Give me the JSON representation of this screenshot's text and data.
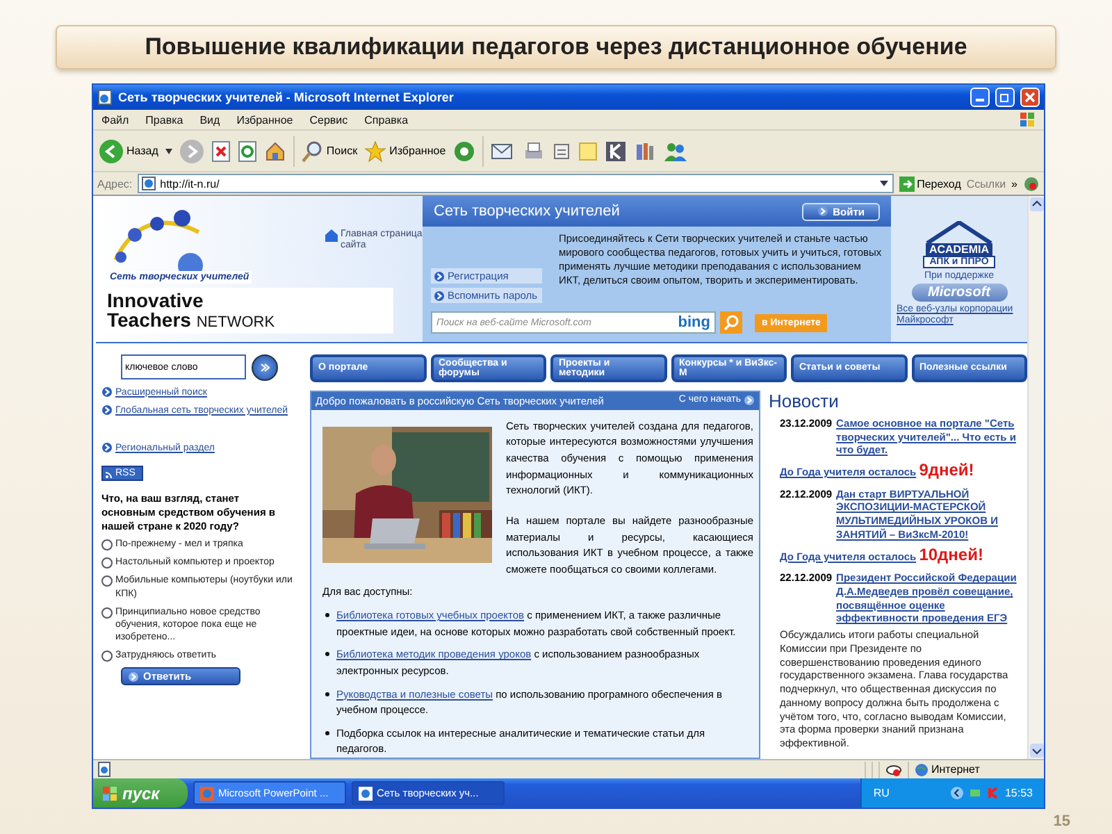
{
  "slide": {
    "title": "Повышение квалификации педагогов через дистанционное обучение",
    "number": "15"
  },
  "window": {
    "title": "Сеть творческих учителей - Microsoft Internet Explorer"
  },
  "menu": [
    "Файл",
    "Правка",
    "Вид",
    "Избранное",
    "Сервис",
    "Справка"
  ],
  "toolbar": {
    "back": "Назад",
    "search": "Поиск",
    "favorites": "Избранное"
  },
  "address": {
    "label": "Адрес:",
    "value": "http://it-n.ru/",
    "go": "Переход",
    "links": "Ссылки",
    "more": "»"
  },
  "header": {
    "logo_caption": "Сеть творческих учителей",
    "logo_line1": "Innovative",
    "logo_line2_bold": "Teachers",
    "logo_line2": "NETWORK",
    "home_link": "Главная страница сайта",
    "panel_title": "Сеть творческих учителей",
    "login": "Войти",
    "intro": "Присоединяйтесь к Сети творческих учителей и станьте частью мирового сообщества педагогов, готовых учить и учиться, готовых применять лучшие методики преподавания с использованием ИКТ, делиться своим опытом, творить и экспериментировать.",
    "links": [
      "Регистрация",
      "Вспомнить пароль"
    ],
    "search_placeholder": "Поиск на веб-сайте Microsoft.com",
    "search_brand": "bing",
    "internet_button": "в Интернете",
    "academia": "ACADEMIA",
    "academia_sub": "АПК и ППРО",
    "support": "При поддержке",
    "microsoft": "Microsoft",
    "ms_link": "Все веб-узлы корпорации Майкрософт"
  },
  "sidebar": {
    "keyword": "ключевое слово",
    "links": [
      "Расширенный поиск",
      "Глобальная сеть творческих учителей",
      "Региональный раздел"
    ],
    "rss": "RSS",
    "poll": {
      "question": "Что, на ваш взгляд, станет основным средством обучения в нашей стране к 2020 году?",
      "options": [
        {
          "label": "По-прежнему - мел и тряпка",
          "selected": false
        },
        {
          "label": "Настольный компьютер и проектор",
          "selected": false
        },
        {
          "label": "Мобильные компьютеры (ноутбуки или КПК)",
          "selected": false
        },
        {
          "label": "Принципиально новое средство обучения, которое пока еще не изобретено...",
          "selected": false
        },
        {
          "label": "Затрудняюсь ответить",
          "selected": false
        }
      ],
      "button": "Ответить"
    }
  },
  "nav": [
    "О портале",
    "Сообщества и форумы",
    "Проекты и методики",
    "Конкурсы * и ВиЗкс-М",
    "Статьи и советы",
    "Полезные ссылки"
  ],
  "welcome": {
    "title": "Добро пожаловать в российскую Сеть творческих учителей",
    "start": "С чего начать",
    "paragraphs": [
      "Сеть творческих учителей создана для педагогов, которые интересуются возможностями улучшения качества обучения с помощью применения информационных и коммуникационных технологий (ИКТ).",
      "На нашем портале вы найдете разнообразные материалы и ресурсы, касающиеся использования ИКТ в учебном процессе, а также сможете пообщаться со своими коллегами."
    ],
    "available": "Для вас доступны:",
    "bullets": [
      {
        "link": "Библиотека готовых учебных проектов",
        "text": " с применением ИКТ, а также различные проектные идеи, на основе которых можно разработать свой собственный проект."
      },
      {
        "link": "Библиотека методик проведения уроков",
        "text": " с использованием разнообразных электронных ресурсов."
      },
      {
        "link": "Руководства и полезные советы",
        "text": " по использованию програмного обеспечения в учебном процессе."
      },
      {
        "text": "Подборка ссылок на интересные аналитические и тематические статьи для педагогов."
      }
    ]
  },
  "news": {
    "title": "Новости",
    "items": [
      {
        "date": "23.12.2009",
        "link": "Самое основное на портале \"Сеть творческих учителей\"... Что есть и что будет.",
        "countdown": {
          "label": "До Года учителя осталось",
          "days": "9дней!"
        }
      },
      {
        "date": "22.12.2009",
        "link": "Дан старт ВИРТУАЛЬНОЙ ЭКСПОЗИЦИИ-МАСТЕРСКОЙ МУЛЬТИМЕДИЙНЫХ УРОКОВ И ЗАНЯТИЙ – ВиЗксМ-2010!",
        "countdown": {
          "label": "До Года учителя осталось",
          "days": "10дней!"
        }
      },
      {
        "date": "22.12.2009",
        "link": "Президент Российской Федерации Д.А.Медведев провёл совещание, посвящённое оценке эффективности проведения ЕГЭ",
        "body": "Обсуждались итоги работы специальной Комиссии при Президенте по совершенствованию проведения единого государственного экзамена. Глава государства подчеркнул, что общественная дискуссия по данному вопросу должна быть продолжена с учётом того, что, согласно выводам Комиссии, эта форма проверки знаний признана эффективной."
      }
    ]
  },
  "status_bar": {
    "zone": "Интернет"
  },
  "taskbar": {
    "start": "пуск",
    "tasks": [
      {
        "label": "Microsoft PowerPoint ...",
        "selected": false
      },
      {
        "label": "Сеть творческих уч...",
        "selected": true
      }
    ],
    "lang": "RU",
    "time": "15:53"
  }
}
